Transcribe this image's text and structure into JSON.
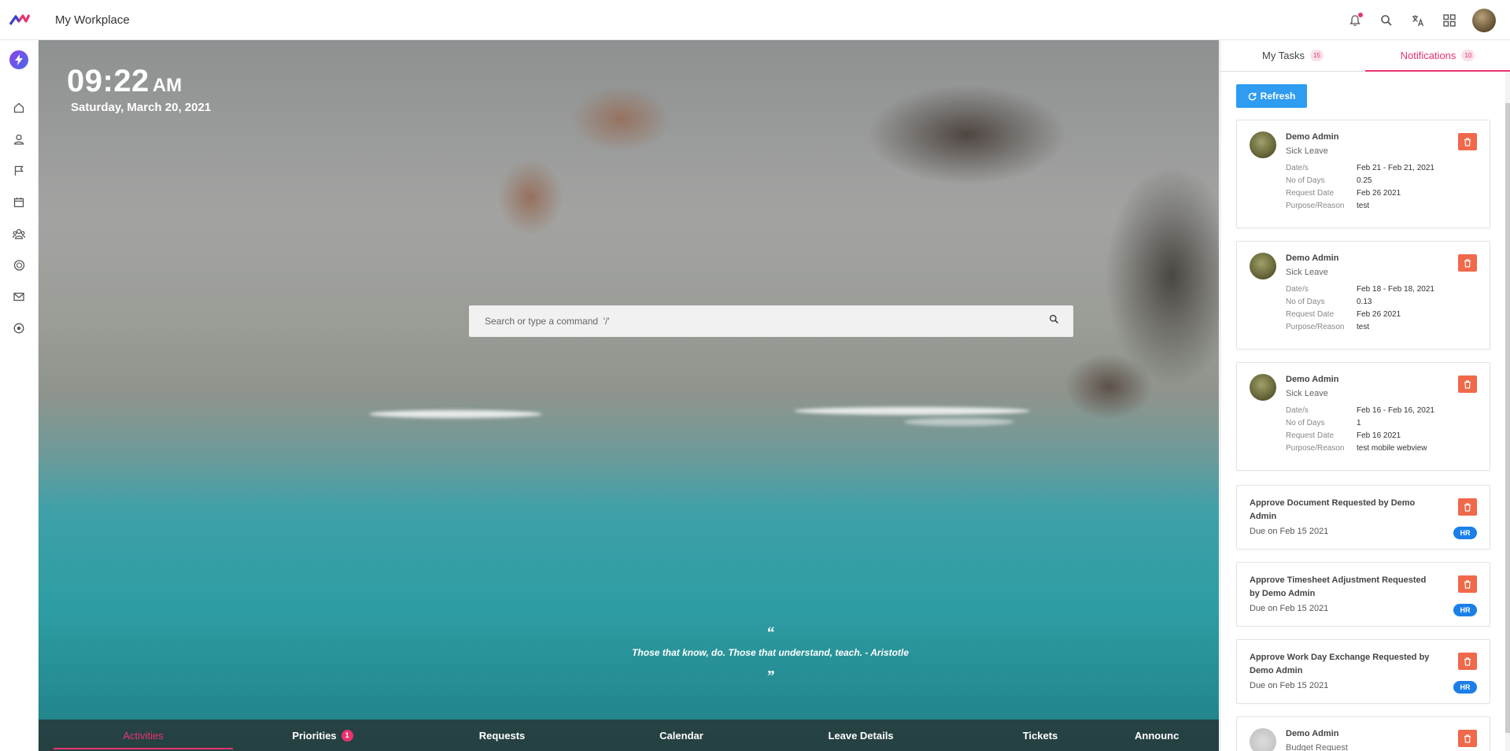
{
  "app": {
    "title": "My Workplace"
  },
  "topbar": {
    "icons": [
      "notification-bell-icon",
      "search-icon",
      "translate-icon",
      "apps-grid-icon"
    ]
  },
  "sidebar": {
    "items": [
      "home-icon",
      "user-icon",
      "flag-icon",
      "calendar-icon",
      "team-icon",
      "payroll-icon",
      "mail-icon",
      "target-icon"
    ]
  },
  "hero": {
    "time": "09:22",
    "ampm": "AM",
    "date": "Saturday, March 20, 2021",
    "search_placeholder": "Search or type a command  '/'",
    "quote_open": "“",
    "quote": "Those that know, do. Those that understand, teach. - Aristotle",
    "quote_close": "”"
  },
  "bottom_tabs": [
    {
      "label": "Activities"
    },
    {
      "label": "Priorities",
      "badge": "1"
    },
    {
      "label": "Requests"
    },
    {
      "label": "Calendar"
    },
    {
      "label": "Leave Details"
    },
    {
      "label": "Tickets"
    },
    {
      "label": "Announc"
    }
  ],
  "panel": {
    "tabs": [
      {
        "label": "My Tasks",
        "count": "15"
      },
      {
        "label": "Notifications",
        "count": "10"
      }
    ],
    "refresh_label": "Refresh",
    "leave_cards": [
      {
        "name": "Demo Admin",
        "type": "Sick Leave",
        "rows": [
          {
            "label": "Date/s",
            "value": "Feb 21 - Feb 21, 2021"
          },
          {
            "label": "No of Days",
            "value": "0.25"
          },
          {
            "label": "Request Date",
            "value": "Feb 26 2021"
          },
          {
            "label": "Purpose/Reason",
            "value": "test"
          }
        ]
      },
      {
        "name": "Demo Admin",
        "type": "Sick Leave",
        "rows": [
          {
            "label": "Date/s",
            "value": "Feb 18 - Feb 18, 2021"
          },
          {
            "label": "No of Days",
            "value": "0.13"
          },
          {
            "label": "Request Date",
            "value": "Feb 26 2021"
          },
          {
            "label": "Purpose/Reason",
            "value": "test"
          }
        ]
      },
      {
        "name": "Demo Admin",
        "type": "Sick Leave",
        "rows": [
          {
            "label": "Date/s",
            "value": "Feb 16 - Feb 16, 2021"
          },
          {
            "label": "No of Days",
            "value": "1"
          },
          {
            "label": "Request Date",
            "value": "Feb 16 2021"
          },
          {
            "label": "Purpose/Reason",
            "value": "test mobile webview"
          }
        ]
      }
    ],
    "task_cards": [
      {
        "title": "Approve Document Requested by Demo Admin",
        "due": "Due on Feb 15 2021",
        "badge": "HR"
      },
      {
        "title": "Approve Timesheet Adjustment Requested by Demo Admin",
        "due": "Due on Feb 15 2021",
        "badge": "HR"
      },
      {
        "title": "Approve Work Day Exchange Requested by Demo Admin",
        "due": "Due on Feb 15 2021",
        "badge": "HR"
      }
    ],
    "partial_card": {
      "name": "Demo Admin",
      "type": "Budget Request"
    }
  },
  "colors": {
    "accent": "#e8336f",
    "refresh": "#2e9cf0",
    "delete": "#f0694a",
    "hr_badge": "#1c7fe8"
  }
}
